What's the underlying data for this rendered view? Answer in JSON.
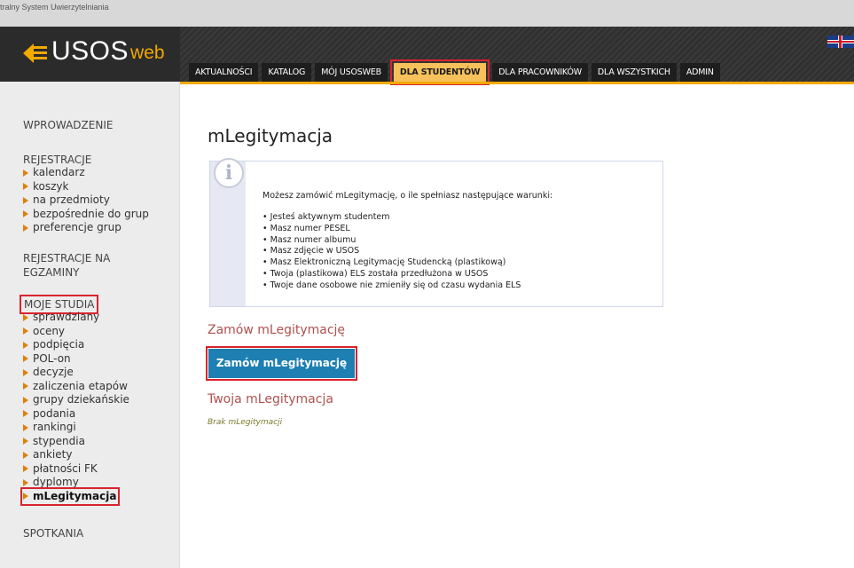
{
  "app": {
    "system_title": "tralny System Uwierzytelniania",
    "logo_main": "USOS",
    "logo_sub": "web"
  },
  "nav": {
    "tabs": [
      {
        "label": "AKTUALNOŚCI"
      },
      {
        "label": "KATALOG"
      },
      {
        "label": "MÓJ USOSWEB"
      },
      {
        "label": "DLA STUDENTÓW",
        "active": true
      },
      {
        "label": "DLA PRACOWNIKÓW"
      },
      {
        "label": "DLA WSZYSTKICH"
      },
      {
        "label": "ADMIN"
      }
    ]
  },
  "sidebar": {
    "wprowadzenie": "WPROWADZENIE",
    "rejestracje": {
      "title": "REJESTRACJE",
      "items": [
        "kalendarz",
        "koszyk",
        "na przedmioty",
        "bezpośrednie do grup",
        "preferencje grup"
      ]
    },
    "rejestracje_egzaminy": {
      "line1": "REJESTRACJE NA",
      "line2": "EGZAMINY"
    },
    "moje_studia": {
      "title": "MOJE STUDIA",
      "items": [
        "sprawdziany",
        "oceny",
        "podpięcia",
        "POL-on",
        "decyzje",
        "zaliczenia etapów",
        "grupy dziekańskie",
        "podania",
        "rankingi",
        "stypendia",
        "ankiety",
        "płatności FK",
        "dyplomy",
        "mLegitymacja"
      ],
      "current": "mLegitymacja"
    },
    "spotkania": "SPOTKANIA"
  },
  "main": {
    "title": "mLegitymacja",
    "info": {
      "intro": "Możesz zamówić mLegitymację, o ile spełniasz następujące warunki:",
      "conditions": [
        "Jesteś aktywnym studentem",
        "Masz numer PESEL",
        "Masz numer albumu",
        "Masz zdjęcie w USOS",
        "Masz Elektroniczną Legitymację Studencką (plastikową)",
        "Twoja (plastikowa) ELS została przedłużona w USOS",
        "Twoje dane osobowe nie zmieniły się od czasu wydania ELS"
      ]
    },
    "order_heading": "Zamów mLegitymację",
    "order_button": "Zamów mLegitymację",
    "yours_heading": "Twoja mLegitymacja",
    "none_text": "Brak mLegitymacji"
  },
  "colors": {
    "accent": "#f2a900",
    "button": "#1e7fb3",
    "heading": "#b05050",
    "highlight": "#d9232d"
  }
}
